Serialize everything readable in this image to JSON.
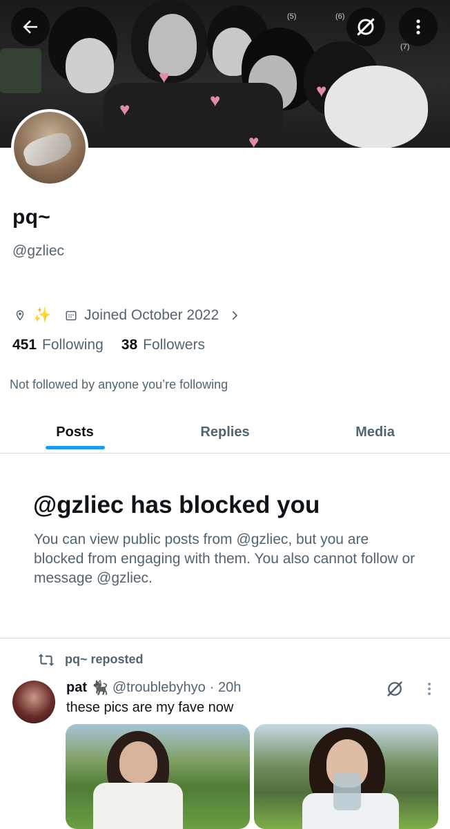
{
  "banner": {
    "marks": [
      "(5)",
      "(6)",
      "(7)"
    ]
  },
  "icons": {
    "back": "arrow-left-icon",
    "grok": "grok-icon",
    "more": "more-vertical-icon",
    "location": "location-pin-icon",
    "calendar": "calendar-icon",
    "chevron": "chevron-right-icon",
    "repost": "repost-icon"
  },
  "profile": {
    "name": "pq~",
    "handle": "@gzliec",
    "location": "✨",
    "joined": "Joined October 2022",
    "following_count": "451",
    "following_label": "Following",
    "followers_count": "38",
    "followers_label": "Followers",
    "not_followed": "Not followed by anyone you’re following"
  },
  "tabs": [
    {
      "label": "Posts",
      "active": true
    },
    {
      "label": "Replies",
      "active": false
    },
    {
      "label": "Media",
      "active": false
    }
  ],
  "blocked": {
    "title": "@gzliec has blocked you",
    "body": "You can view public posts from @gzliec, but you are blocked from engaging with them. You also cannot follow or message @gzliec."
  },
  "post": {
    "repost_label": "pq~ reposted",
    "author_name": "pat",
    "author_emoji": "🐈‍⬛",
    "author_handle": "@troublebyhyo",
    "time": "· 20h",
    "text": "these pics are my fave now"
  },
  "colors": {
    "accent": "#1d9bf0",
    "secondary_text": "#536471",
    "primary_text": "#0f1419",
    "border": "#cfd9de"
  }
}
